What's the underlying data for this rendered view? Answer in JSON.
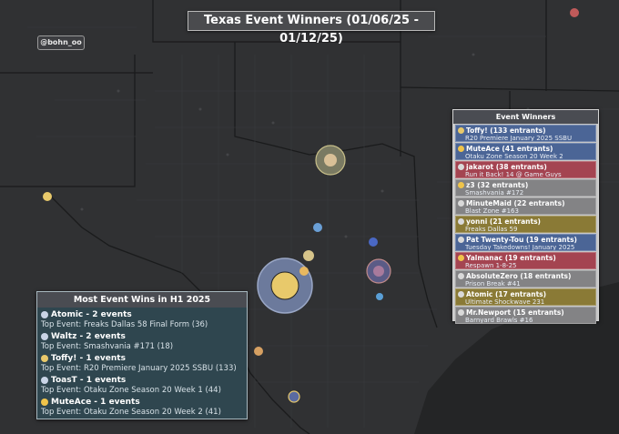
{
  "title": "Texas Event Winners (01/06/25 - 01/12/25)",
  "handle": "@bohn_oo",
  "winners_panel": {
    "header": "Event Winners",
    "rows": [
      {
        "name": "Toffy! (133 entrants)",
        "event": "R20 Premiere January 2025 SSBU",
        "color": "#4b6596",
        "icon": "trophy-icon"
      },
      {
        "name": "MuteAce (41 entrants)",
        "event": "Otaku Zone Season 20 Week 2",
        "color": "#4b6596",
        "icon": "star-icon"
      },
      {
        "name": "jakarot (38 entrants)",
        "event": "Run it Back! 14 @ Game Guys",
        "color": "#a44451",
        "icon": "fighter-icon"
      },
      {
        "name": "z3 (32 entrants)",
        "event": "Smashvania #172",
        "color": "#838385",
        "icon": "star-icon"
      },
      {
        "name": "MinuteMaid (22 entrants)",
        "event": "Blast Zone #163",
        "color": "#838385",
        "icon": "fighter-icon"
      },
      {
        "name": "yonni (21 entrants)",
        "event": "Freaks Dallas 59",
        "color": "#8a7a36",
        "icon": "fighter-icon"
      },
      {
        "name": "Pat Twenty-Tou (19 entrants)",
        "event": "Tuesday Takedowns! January 2025",
        "color": "#4b6596",
        "icon": "fighter-icon"
      },
      {
        "name": "Yalmanac (19 entrants)",
        "event": "Respawn 1-8-25",
        "color": "#a44451",
        "icon": "star-icon"
      },
      {
        "name": "AbsoluteZero (18 entrants)",
        "event": "Prison Break #41",
        "color": "#838385",
        "icon": "fighter-icon"
      },
      {
        "name": "Atomic (17 entrants)",
        "event": "Ultimate Shockwave 231",
        "color": "#8a7a36",
        "icon": "fighter-icon"
      },
      {
        "name": "Mr.Newport (15 entrants)",
        "event": "Barnyard Brawls #16",
        "color": "#838385",
        "icon": "fighter-icon"
      }
    ]
  },
  "most_wins_panel": {
    "header": "Most Event Wins in H1 2025",
    "items": [
      {
        "name": "Atomic - 2 events",
        "top_event": "Top Event: Freaks Dallas 58 Final Form (36)",
        "icon": "fighter-icon"
      },
      {
        "name": "Waltz - 2 events",
        "top_event": "Top Event: Smashvania #171 (18)",
        "icon": "fighter-icon"
      },
      {
        "name": "Toffy! - 1 events",
        "top_event": "Top Event: R20 Premiere January 2025 SSBU (133)",
        "icon": "trophy-icon"
      },
      {
        "name": "ToasT - 1 events",
        "top_event": "Top Event: Otaku Zone Season 20 Week 1 (44)",
        "icon": "fighter-icon"
      },
      {
        "name": "MuteAce - 1 events",
        "top_event": "Top Event: Otaku Zone Season 20 Week 2 (41)",
        "icon": "star-icon"
      }
    ]
  },
  "colors": {
    "background": "#303133",
    "border_lines": "#1c1d1f",
    "blue_row": "#4b6596",
    "red_row": "#a44451",
    "gray_row": "#838385",
    "gold_row": "#8a7a36"
  }
}
